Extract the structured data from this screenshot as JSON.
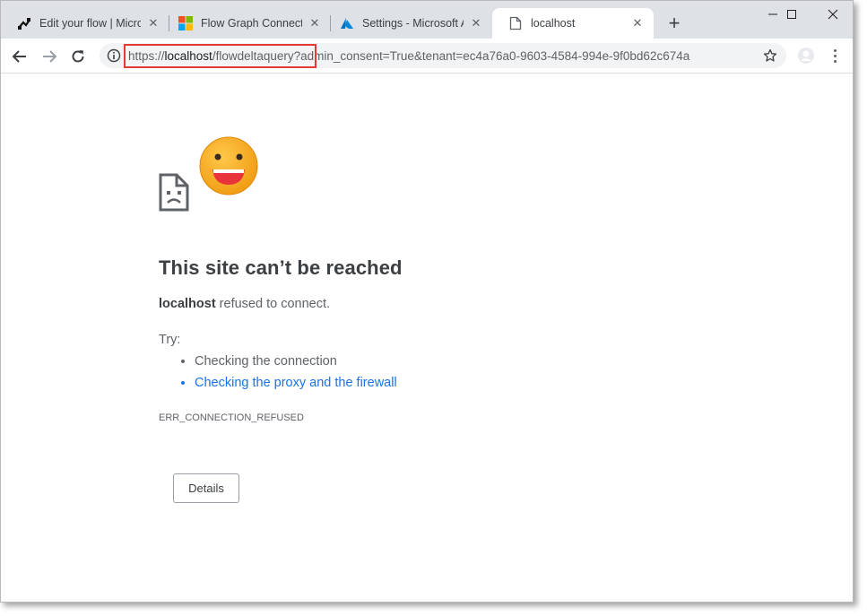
{
  "tabs": [
    {
      "title": "Edit your flow | Micro",
      "icon": "flow-icon"
    },
    {
      "title": "Flow Graph Connectio",
      "icon": "microsoft-logo-icon"
    },
    {
      "title": "Settings - Microsoft A",
      "icon": "azure-icon"
    },
    {
      "title": "localhost",
      "icon": "page-icon",
      "active": true
    }
  ],
  "address_bar": {
    "scheme": "https://",
    "host": "localhost",
    "rest": "/flowdeltaquery?admin_consent=True&tenant=ec4a76a0-9603-4584-994e-9f0bd62c674a"
  },
  "colors": {
    "highlight": "#e53935",
    "link": "#1a73e8",
    "smiley": "#f4a11c"
  },
  "error": {
    "heading": "This site can’t be reached",
    "host": "localhost",
    "message": " refused to connect.",
    "try_label": "Try:",
    "suggestions": [
      "Checking the connection",
      "Checking the proxy and the firewall"
    ],
    "code": "ERR_CONNECTION_REFUSED",
    "details_button": "Details"
  }
}
